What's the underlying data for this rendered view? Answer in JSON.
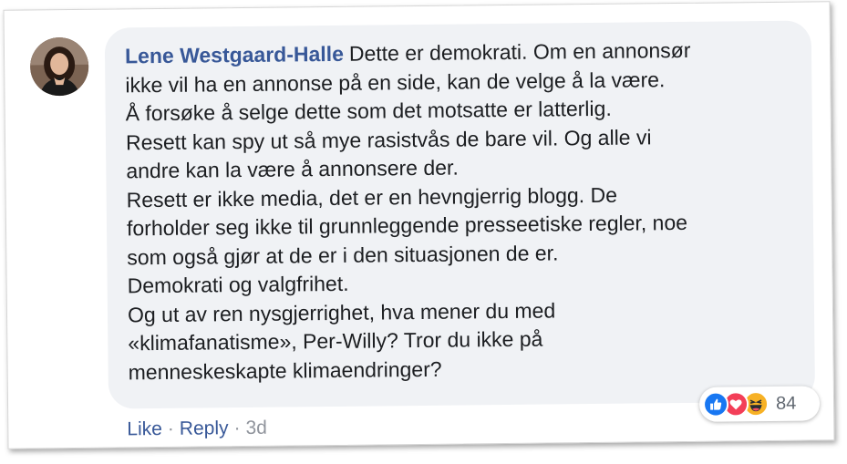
{
  "comment": {
    "author": "Lene Westgaard-Halle",
    "lines": [
      "Dette er demokrati. Om en annonsør",
      "ikke vil ha en annonse på en side, kan de velge å la være.",
      "Å forsøke å selge dette som det motsatte er latterlig.",
      "Resett kan spy ut så mye rasistvås de bare vil. Og alle vi",
      "andre kan la være å annonsere der.",
      "Resett er ikke media, det er en hevngjerrig blogg. De",
      "forholder seg ikke til grunnleggende presseetiske regler, noe",
      "som også gjør at de er i den situasjonen de er.",
      "Demokrati og valgfrihet.",
      "Og ut av ren nysgjerrighet, hva mener du med",
      "«klimafanatisme», Per-Willy? Tror du ikke på",
      "menneskeskapte klimaendringer?"
    ]
  },
  "reactions": {
    "icons": [
      "like-icon",
      "love-icon",
      "haha-icon"
    ],
    "count": "84",
    "colors": {
      "like": "#1877f2",
      "love": "#f33e58",
      "haha": "#f7b125"
    }
  },
  "actions": {
    "like": "Like",
    "separator": "·",
    "reply": "Reply",
    "time": "3d"
  },
  "colors": {
    "link": "#385898",
    "bubble": "#f0f2f5",
    "text": "#1c1e21",
    "meta": "#90949c"
  }
}
